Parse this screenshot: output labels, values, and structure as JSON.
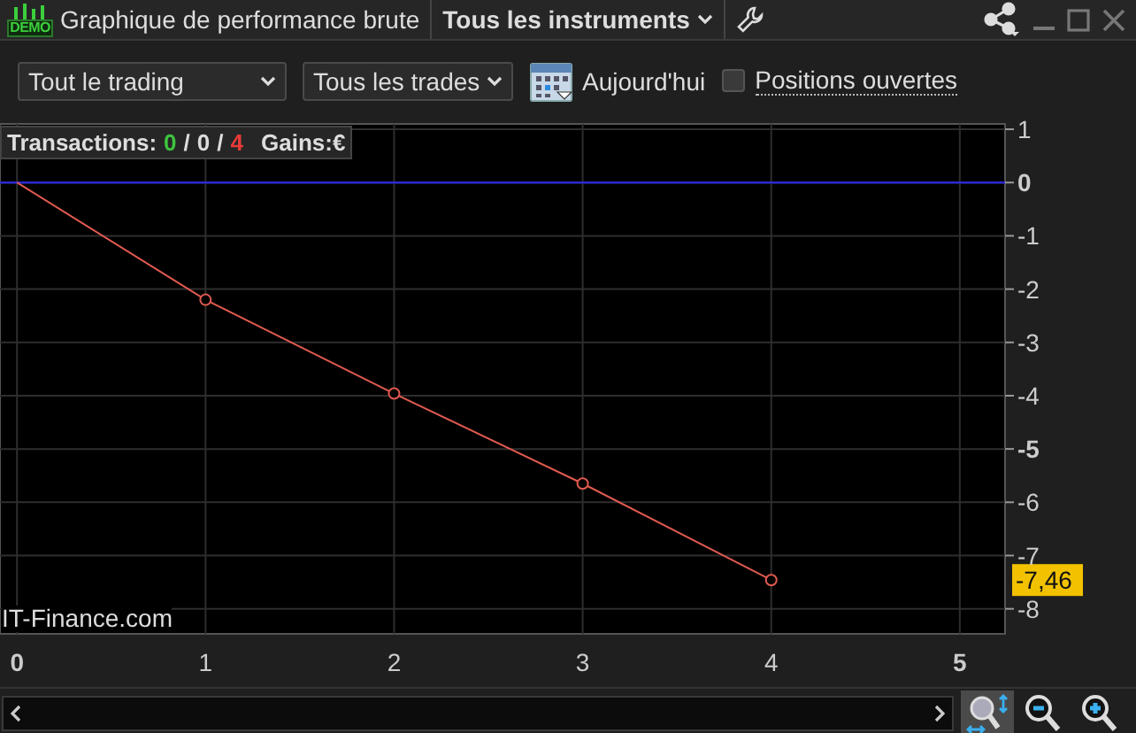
{
  "title_bar": {
    "logo": "DEMO",
    "title": "Graphique de performance brute",
    "instrument": "Tous les instruments"
  },
  "toolbar": {
    "scope": "Tout le trading",
    "trades": "Tous les trades",
    "date": "Aujourd'hui",
    "open_positions": {
      "label": "Positions ouvertes",
      "checked": false
    }
  },
  "chart": {
    "summary": {
      "label": "Transactions:",
      "counts": [
        {
          "text": "0",
          "color": "#3dc43d"
        },
        {
          "text": "0",
          "color": "#dcdcdc"
        },
        {
          "text": "4",
          "color": "#e83a3a"
        }
      ],
      "separator": "/",
      "gains": "Gains:€"
    },
    "watermark": "IT-Finance.com",
    "chart_data": {
      "type": "line",
      "x": [
        0,
        1,
        2,
        3,
        4
      ],
      "series": [
        {
          "color": "#e05a50",
          "marker": "circle",
          "values": [
            0,
            -2.2,
            -3.96,
            -5.65,
            -7.46
          ]
        }
      ],
      "grid": true,
      "ref_lines": [
        {
          "axis": "y",
          "value": 0,
          "color": "#2a2ad0"
        }
      ],
      "xlim": [
        -0.09,
        5.24
      ],
      "ylim": [
        -8.47,
        1.1
      ],
      "xticks": [
        0,
        1,
        2,
        3,
        4,
        5
      ],
      "yticks": [
        1,
        0,
        -1,
        -2,
        -3,
        -4,
        -5,
        -6,
        -7,
        -8
      ]
    },
    "last_value": {
      "text": "-7,46"
    }
  },
  "zoom_tools": [
    {
      "kind": "fit",
      "selected": true
    },
    {
      "kind": "out",
      "selected": false
    },
    {
      "kind": "in",
      "selected": false
    }
  ]
}
